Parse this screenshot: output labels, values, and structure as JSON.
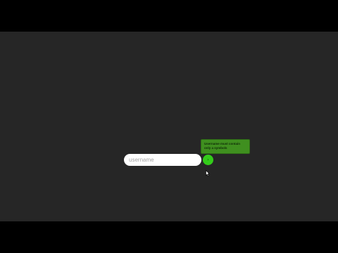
{
  "form": {
    "username_placeholder": "username",
    "username_value": "",
    "submit_icon": "arrow-right-icon",
    "submit_glyph": "›"
  },
  "tooltip": {
    "message": "Username must contain only a symbols"
  },
  "colors": {
    "background": "#262626",
    "letterbox": "#000000",
    "accent": "#33cc1a",
    "tooltip": "#3f8f1f"
  }
}
